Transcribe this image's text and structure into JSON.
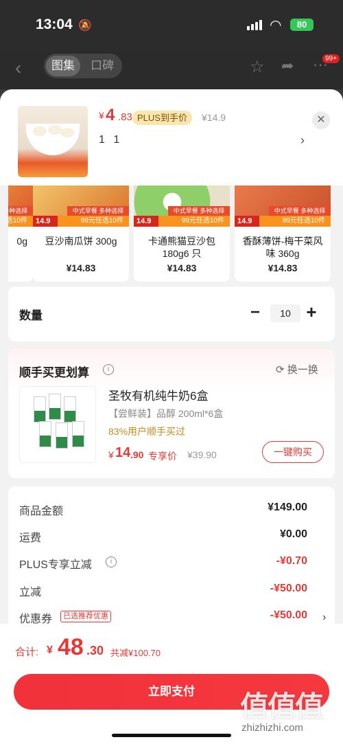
{
  "status_bar": {
    "time": "13:04",
    "battery": "80"
  },
  "header": {
    "tabs": [
      "图集",
      "口碑"
    ],
    "more_badge": "99+"
  },
  "selected": {
    "price_symbol": "¥",
    "price_int": "4",
    "price_dec": ".83",
    "plus_tag": "PLUS到手价",
    "orig_price": "¥14.9",
    "spec": "1 1"
  },
  "carousel": [
    {
      "name": "0g",
      "price": ""
    },
    {
      "name": "豆沙南瓜饼 300g",
      "price": "¥14.83",
      "tag": "14.9",
      "strip": "99元任选10件",
      "strip_top": "中式早餐 多种选择"
    },
    {
      "name": "卡通熊猫豆沙包 180g6 只",
      "price": "¥14.83",
      "tag": "14.9",
      "strip": "99元任选10件",
      "strip_top": "中式早餐 多种选择"
    },
    {
      "name": "香酥薄饼-梅干菜风味 360g",
      "price": "¥14.83",
      "tag": "14.9",
      "strip": "99元任选10件",
      "strip_top": "中式早餐 多种选择"
    }
  ],
  "quantity": {
    "label": "数量",
    "value": "10"
  },
  "recommend": {
    "title": "顺手买更划算",
    "swap": "换一换",
    "product_name": "圣牧有机纯牛奶6盒",
    "product_spec": "【尝鲜装】品醇 200ml*6盒",
    "buy_rate": "83%用户顺手买过",
    "price_symbol": "¥",
    "price_int": "14",
    "price_dec": ".90",
    "price_tag": "专享价",
    "orig_price": "¥39.90",
    "button": "一键购买"
  },
  "summary": {
    "rows": [
      {
        "label": "商品金额",
        "value": "¥149.00"
      },
      {
        "label": "运费",
        "value": "¥0.00"
      },
      {
        "label": "PLUS专享立减",
        "value": "-¥0.70"
      },
      {
        "label": "立减",
        "value": "-¥50.00"
      },
      {
        "label": "优惠券",
        "value": "-¥50.00",
        "tag": "已选推荐优惠"
      }
    ]
  },
  "footer": {
    "total_label": "合计:",
    "total_symbol": "¥",
    "total_int": "48",
    "total_dec": ".30",
    "total_save": "共减¥100.70",
    "pay_button": "立即支付"
  },
  "watermark": {
    "main": "值值值",
    "sub": "zhizhizhi.com"
  },
  "colors": {
    "accent": "#e53935",
    "plus_tag_bg": "#fbe6b0",
    "battery": "#34c759"
  }
}
